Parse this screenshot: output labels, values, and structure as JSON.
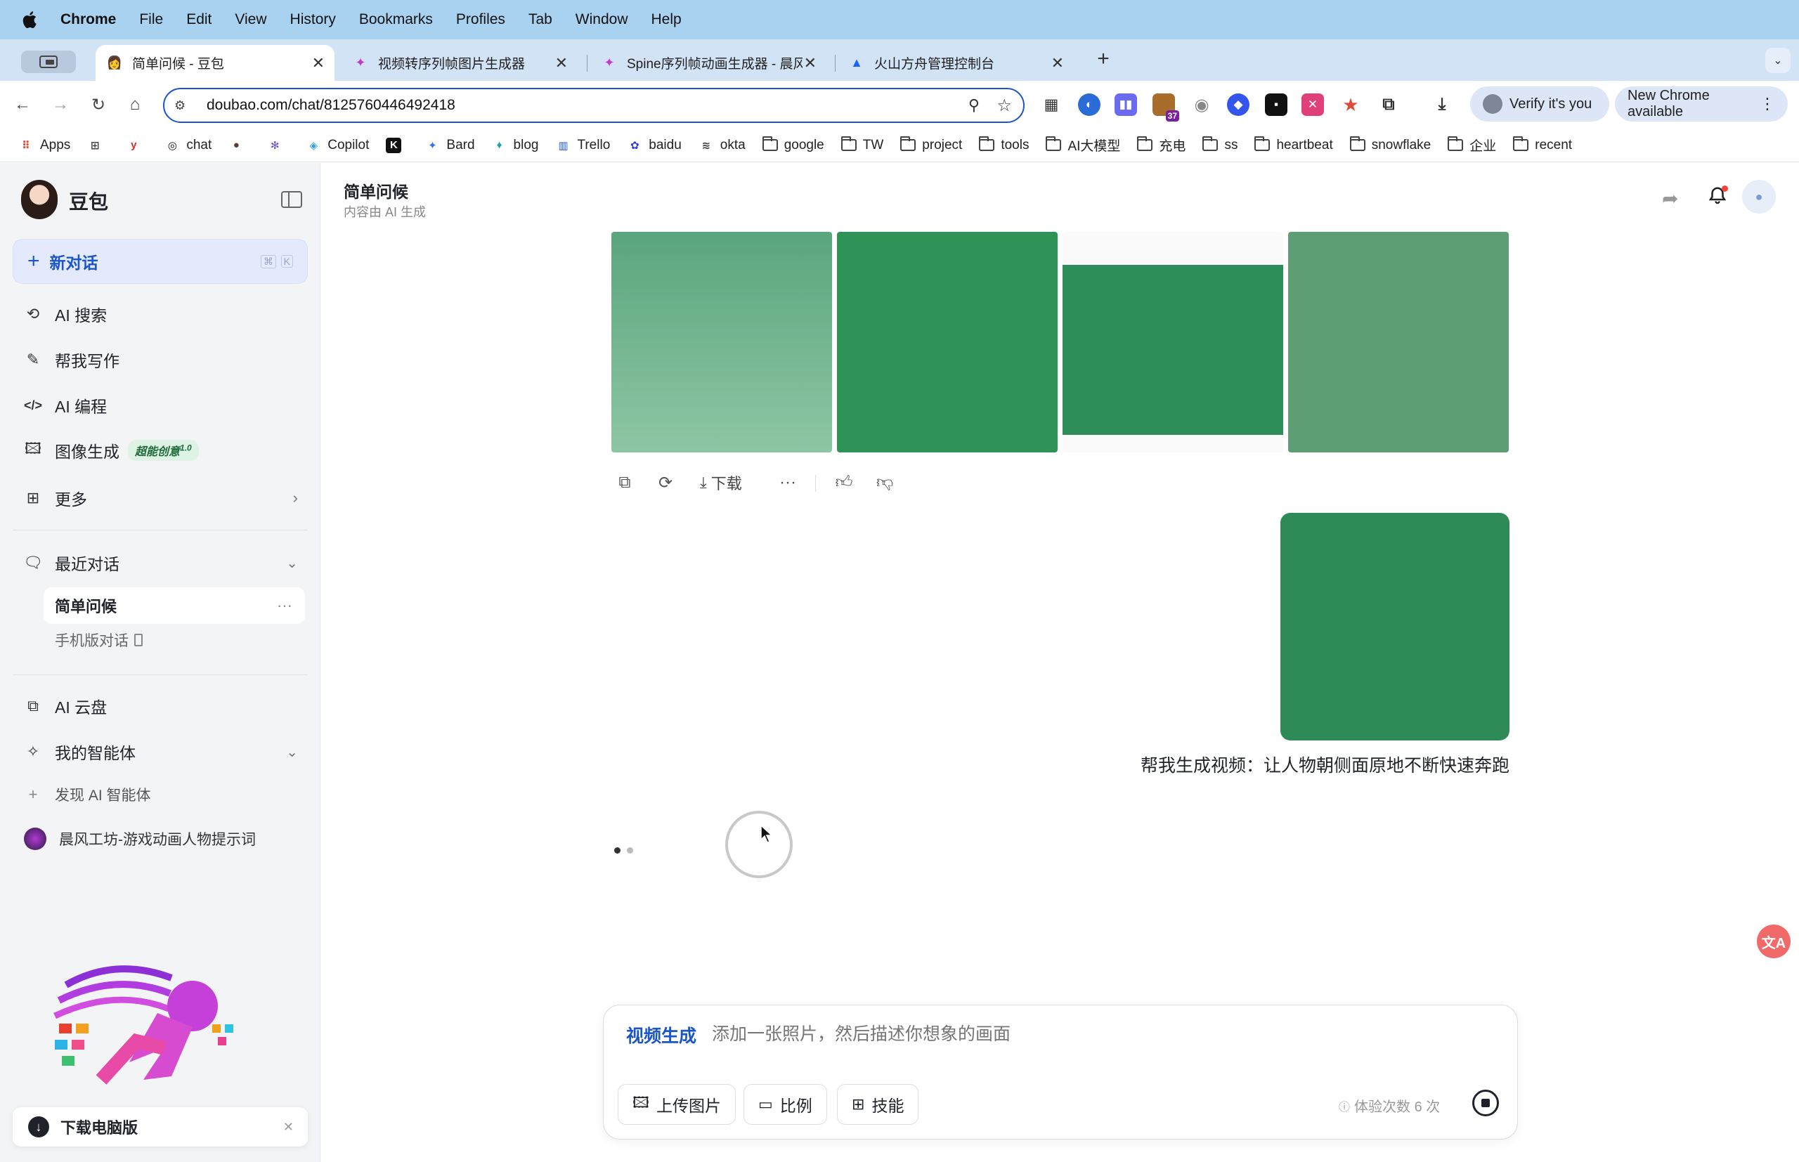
{
  "menubar": {
    "app": "Chrome",
    "items": [
      "File",
      "Edit",
      "View",
      "History",
      "Bookmarks",
      "Profiles",
      "Tab",
      "Window",
      "Help"
    ]
  },
  "tabs": [
    {
      "title": "简单问候 - 豆包",
      "active": true
    },
    {
      "title": "视频转序列帧图片生成器"
    },
    {
      "title": "Spine序列帧动画生成器 - 晨风工"
    },
    {
      "title": "火山方舟管理控制台"
    }
  ],
  "toolbar": {
    "url": "doubao.com/chat/8125760446492418",
    "ext_badge": "37",
    "verify_label": "Verify it's you",
    "update_label": "New Chrome available"
  },
  "bookmarks": [
    {
      "label": "Apps",
      "icon": "apps-grid-icon"
    },
    {
      "label": "",
      "icon": "grid-icon"
    },
    {
      "label": "",
      "icon": "yandex-icon"
    },
    {
      "label": "chat",
      "icon": "openai-icon"
    },
    {
      "label": "",
      "icon": "avatar-icon"
    },
    {
      "label": "",
      "icon": "perplexity-icon"
    },
    {
      "label": "Copilot",
      "icon": "copilot-icon"
    },
    {
      "label": "",
      "icon": "k-icon"
    },
    {
      "label": "Bard",
      "icon": "sparkle-icon"
    },
    {
      "label": "blog",
      "icon": "blog-icon"
    },
    {
      "label": "Trello",
      "icon": "trello-icon"
    },
    {
      "label": "baidu",
      "icon": "paw-icon"
    },
    {
      "label": "okta",
      "icon": "okta-icon"
    },
    {
      "label": "google",
      "icon": "folder-icon"
    },
    {
      "label": "TW",
      "icon": "folder-icon"
    },
    {
      "label": "project",
      "icon": "folder-icon"
    },
    {
      "label": "tools",
      "icon": "folder-icon"
    },
    {
      "label": "AI大模型",
      "icon": "folder-icon"
    },
    {
      "label": "充电",
      "icon": "folder-icon"
    },
    {
      "label": "ss",
      "icon": "folder-icon"
    },
    {
      "label": "heartbeat",
      "icon": "folder-icon"
    },
    {
      "label": "snowflake",
      "icon": "folder-icon"
    },
    {
      "label": "企业",
      "icon": "folder-icon"
    },
    {
      "label": "recent",
      "icon": "folder-icon"
    }
  ],
  "sidebar": {
    "brand": "豆包",
    "new_chat": "新对话",
    "new_chat_shortcut": [
      "⌘",
      "K"
    ],
    "nav": [
      {
        "label": "AI 搜索",
        "icon": "search-refresh-icon"
      },
      {
        "label": "帮我写作",
        "icon": "pen-icon"
      },
      {
        "label": "AI 编程",
        "icon": "code-icon"
      },
      {
        "label": "图像生成",
        "icon": "image-icon",
        "badge": "超能创意",
        "badge_sup": "1.0"
      },
      {
        "label": "更多",
        "icon": "grid-plus-icon"
      }
    ],
    "recent_header": "最近对话",
    "recent": [
      {
        "label": "简单问候",
        "active": true
      },
      {
        "label": "手机版对话"
      }
    ],
    "cloud": "AI 云盘",
    "agents_header": "我的智能体",
    "discover": "发现 AI 智能体",
    "agent": "晨风工坊-游戏动画人物提示词",
    "download": "下载电脑版"
  },
  "header": {
    "title": "简单问候",
    "subtitle": "内容由 AI 生成"
  },
  "message": {
    "actions": {
      "download": "下载"
    },
    "user_text": "帮我生成视频：让人物朝侧面原地不断快速奔跑"
  },
  "input": {
    "mode": "视频生成",
    "placeholder": "添加一张照片，然后描述你想象的画面",
    "chips": [
      {
        "label": "上传图片",
        "icon": "image-upload-icon"
      },
      {
        "label": "比例",
        "icon": "ratio-icon"
      },
      {
        "label": "技能",
        "icon": "skills-icon"
      }
    ],
    "quota": "体验次数 6 次"
  },
  "colors": {
    "accent": "#1a56c8",
    "green_bg": "#2e8b57",
    "sidebar_bg": "#f3f4f6"
  }
}
